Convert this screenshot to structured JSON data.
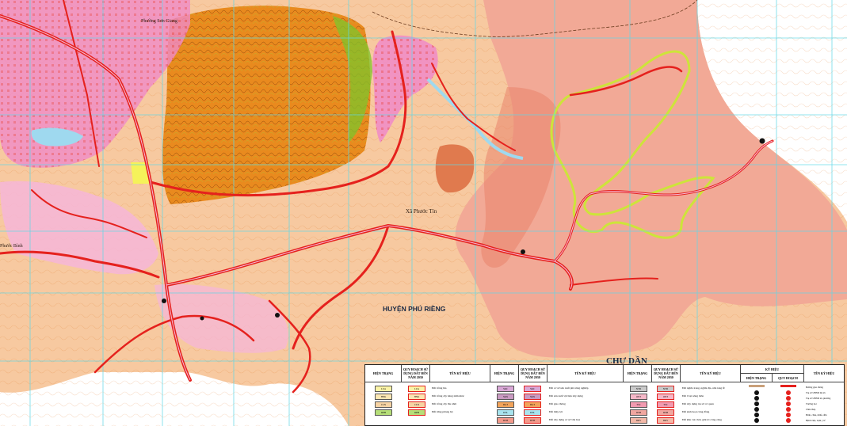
{
  "map": {
    "labels": {
      "ward_son_giang": "Phường Sơn Giang",
      "commune_phuoc_tin": "Xã Phước Tín",
      "phuoc_binh": "Phước Bình",
      "district_phu_rieng": "HUYỆN PHÚ RIỀNG",
      "chu_dan": "CHƯ DẦN"
    },
    "colors": {
      "background": "#ffffff",
      "residential_land": "#fce3cf",
      "agricultural_land": "#f7c9a0",
      "forest_slope": "#e98a1e",
      "forest_green": "#7ec42b",
      "planned_zone": "#f2a996",
      "urban_pink": "#f08ac8",
      "road_red": "#e5211d",
      "contour": "#e07b2c",
      "grid_cyan": "#5fd8e8",
      "water": "#9fd9ef",
      "yellow_accent": "#f5f25a"
    }
  },
  "legend": {
    "headers": {
      "current_1": "HIỆN TRẠNG",
      "plan_1": "QUY HOẠCH SỬ DỤNG ĐẤT ĐẾN NĂM 2030",
      "name_1": "TÊN KÝ HIỆU",
      "current_2": "HIỆN TRẠNG",
      "plan_2": "QUY HOẠCH SỬ DỤNG ĐẤT ĐẾN NĂM 2030",
      "name_2": "TÊN KÝ HIỆU",
      "current_3": "HIỆN TRẠNG",
      "plan_3": "QUY HOẠCH SỬ DỤNG ĐẤT ĐẾN NĂM 2030",
      "name_3": "TÊN KÝ HIỆU",
      "symbol_group": "KÝ HIỆU",
      "symbol_current": "HIỆN TRẠNG",
      "symbol_plan": "QUY HOẠCH",
      "name_4": "TÊN KÝ HIỆU"
    },
    "col1": [
      {
        "label": "Đất trồng lúa",
        "current_code": "LUA",
        "plan_code": "LUA",
        "color": "#fbf4a6"
      },
      {
        "label": "Đất trồng cây hàng năm khác",
        "current_code": "HNK",
        "plan_code": "HNK",
        "color": "#fbe7b3"
      },
      {
        "label": "Đất trồng cây lâu năm",
        "current_code": "CLN",
        "plan_code": "CLN",
        "color": "#f6d3a3"
      },
      {
        "label": "Đất rừng phòng hộ",
        "current_code": "RPH",
        "plan_code": "RPH",
        "color": "#b5de78"
      }
    ],
    "col2": [
      {
        "label": "Đất cơ sở sản xuất phi nông nghiệp",
        "current_code": "SKC",
        "plan_code": "SKC",
        "color": "#d9a7d6"
      },
      {
        "label": "Đất sản xuất vật liệu xây dựng",
        "current_code": "SKX",
        "plan_code": "SKX",
        "color": "#c99ac2"
      },
      {
        "label": "Đất giao thông",
        "current_code": "DGT",
        "plan_code": "DGT",
        "color": "#f2a35a"
      },
      {
        "label": "Đất thủy lợi",
        "current_code": "DTL",
        "plan_code": "DTL",
        "color": "#a8e4ee"
      },
      {
        "label": "Đất xây dựng cơ sở văn hóa",
        "current_code": "DVH",
        "plan_code": "DVH",
        "color": "#f39a8b"
      }
    ],
    "col3": [
      {
        "label": "Đất nghĩa trang, nghĩa địa, nhà tang lễ",
        "current_code": "NTD",
        "plan_code": "NTD",
        "color": "#c9c9c9"
      },
      {
        "label": "Đất ở tại nông thôn",
        "current_code": "ONT",
        "plan_code": "ONT",
        "color": "#f5b8c8"
      },
      {
        "label": "Đất xây dựng trụ sở cơ quan",
        "current_code": "TSC",
        "plan_code": "TSC",
        "color": "#f19ab0"
      },
      {
        "label": "Đất sinh hoạt cộng đồng",
        "current_code": "DSH",
        "plan_code": "DSH",
        "color": "#f0a7a0"
      },
      {
        "label": "Đất khu vui chơi, giải trí công cộng",
        "current_code": "DKV",
        "plan_code": "DKV",
        "color": "#f4b9a8"
      }
    ],
    "symbols": [
      {
        "label": "Đường giao thông",
        "icon": "road-line-icon"
      },
      {
        "label": "Trụ sở UBND thị xã",
        "icon": "city-hall-icon"
      },
      {
        "label": "Trụ sở UBND xã, phường",
        "icon": "commune-hall-icon"
      },
      {
        "label": "Trường học",
        "icon": "school-icon"
      },
      {
        "label": "Chùa tháp",
        "icon": "pagoda-icon"
      },
      {
        "label": "Đình, chùa, miếu, đền",
        "icon": "temple-icon"
      },
      {
        "label": "Bệnh viện, trạm y tế",
        "icon": "hospital-icon"
      }
    ]
  }
}
